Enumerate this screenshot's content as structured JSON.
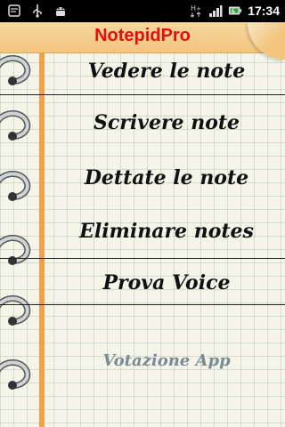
{
  "status_bar": {
    "time": "17:34",
    "icons": [
      "usb-icon",
      "debug-android-icon",
      "data-hplus-icon",
      "signal-icon",
      "battery-icon"
    ],
    "data_label": "H+"
  },
  "app": {
    "title": "NotepidPro"
  },
  "menu": {
    "items": [
      {
        "label": "Vedere le note"
      },
      {
        "label": "Scrivere note"
      },
      {
        "label": "Dettate le note"
      },
      {
        "label": "Eliminare notes"
      },
      {
        "label": "Prova Voice"
      },
      {
        "label": "Votazione App"
      }
    ]
  },
  "colors": {
    "title_text": "#e01010",
    "title_bar": "#f3c57f",
    "margin_line": "#f2a04a",
    "rating_text": "#7a8a96"
  }
}
